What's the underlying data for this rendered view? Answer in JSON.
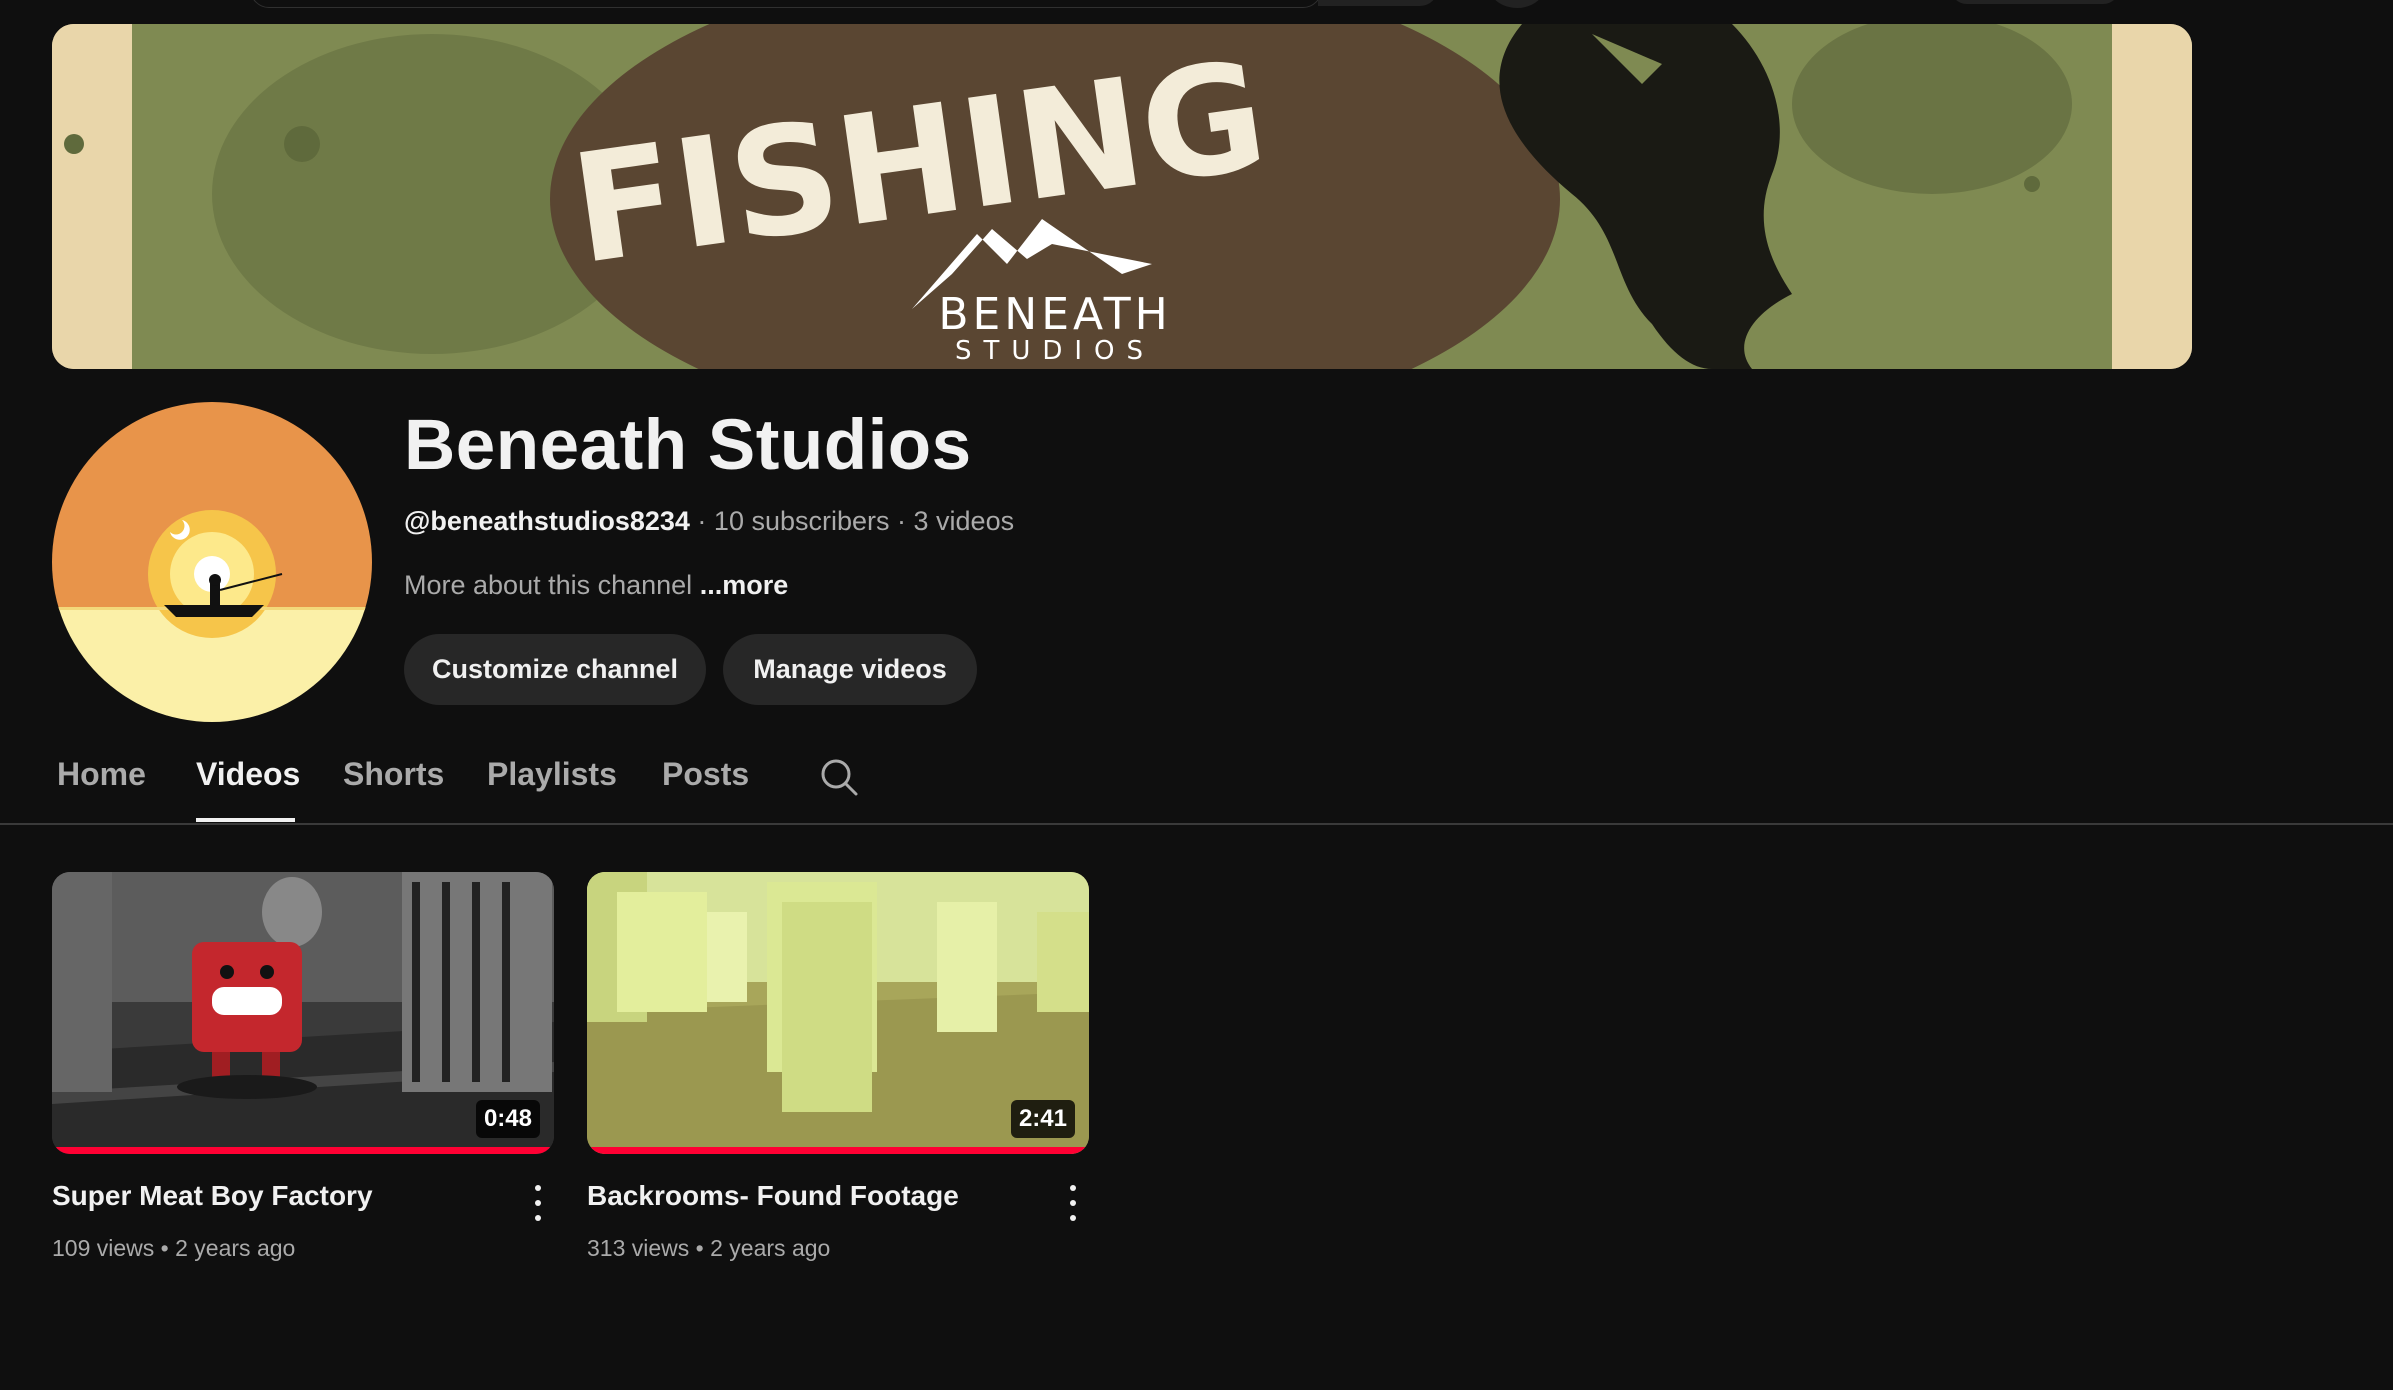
{
  "banner": {
    "headline": "FISHING",
    "logo_line1": "BENEATH",
    "logo_line2": "STUDIOS"
  },
  "channel": {
    "name": "Beneath Studios",
    "handle": "@beneathstudios8234",
    "subscribers": "10 subscribers",
    "video_count": "3 videos",
    "separator": " · ",
    "about_text": "More about this channel",
    "about_more": "...more"
  },
  "actions": {
    "customize_label": "Customize channel",
    "manage_label": "Manage videos"
  },
  "tabs": [
    {
      "label": "Home",
      "active": false
    },
    {
      "label": "Videos",
      "active": true
    },
    {
      "label": "Shorts",
      "active": false
    },
    {
      "label": "Playlists",
      "active": false
    },
    {
      "label": "Posts",
      "active": false
    }
  ],
  "videos": [
    {
      "title": "Super Meat Boy Factory",
      "duration": "0:48",
      "views": "109 views",
      "age": "2 years ago",
      "watched_progress": 1.0
    },
    {
      "title": "Backrooms- Found Footage",
      "duration": "2:41",
      "views": "313 views",
      "age": "2 years ago",
      "watched_progress": 1.0
    }
  ],
  "meta_dot": " • ",
  "icons": {
    "tab_search": "search-icon",
    "video_menu": "more-vert-icon"
  },
  "colors": {
    "background": "#0f0f0f",
    "progress": "#ff0033",
    "button_bg": "#272727",
    "banner_green": "#7f8a52",
    "banner_brown": "#5a4632",
    "avatar_orange": "#e8944a",
    "avatar_yellow": "#fbf0a8"
  }
}
